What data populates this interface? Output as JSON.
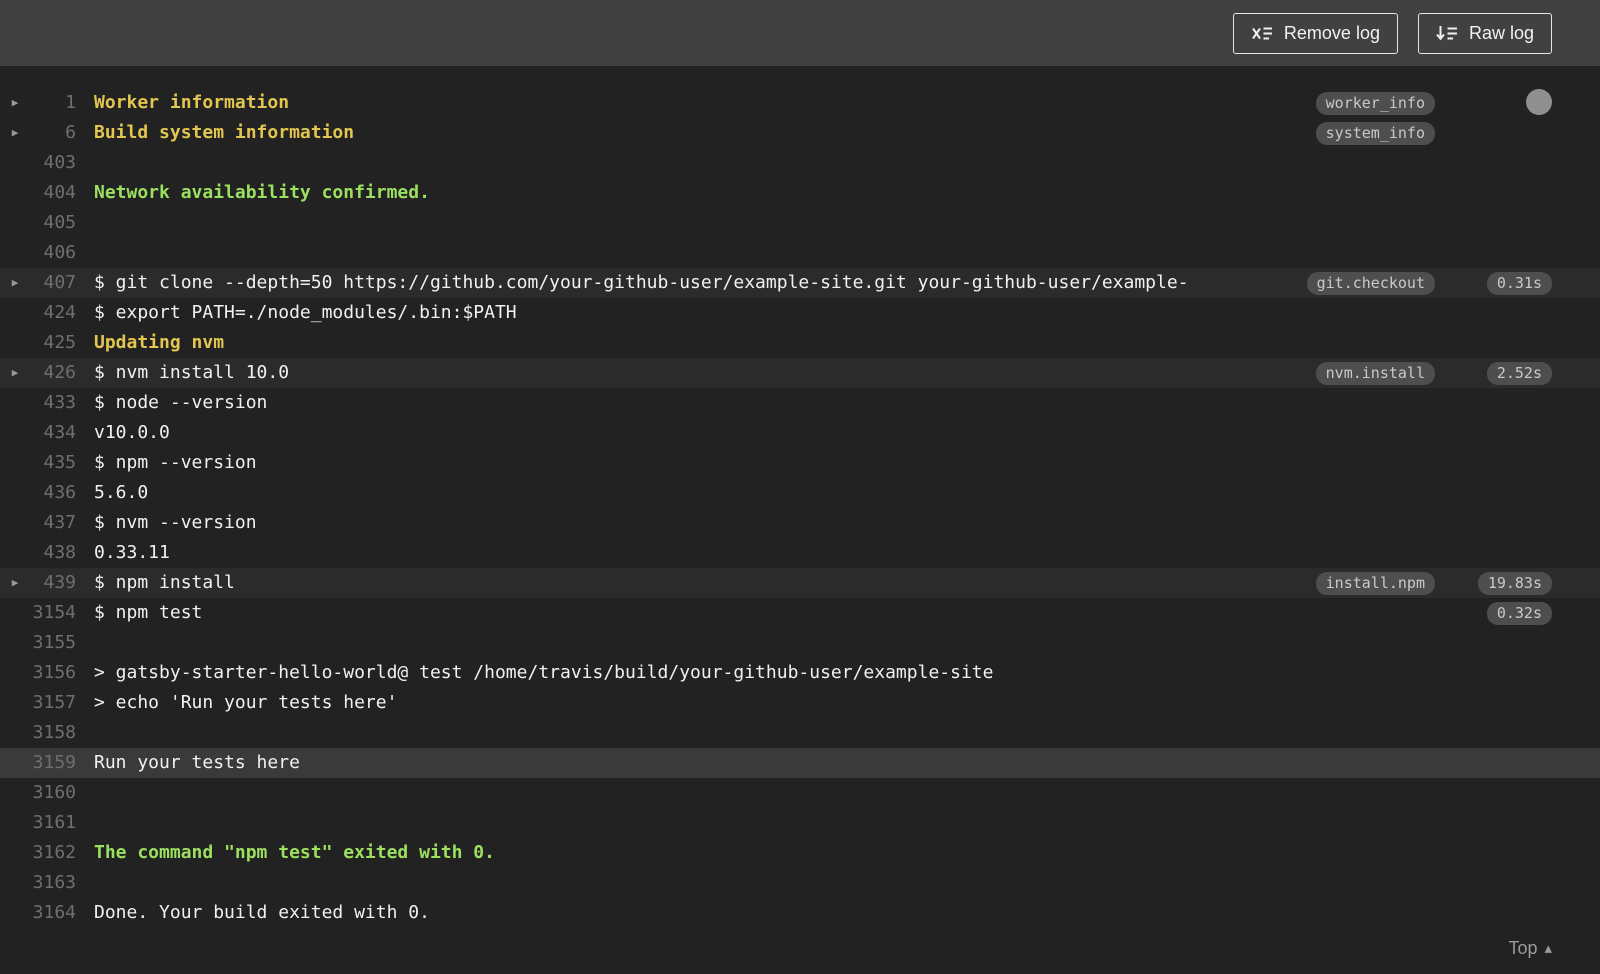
{
  "colors": {
    "page_bg": "#222222",
    "toolbar_bg": "#414141",
    "text": "#f1f1f1",
    "line_number": "#6f6f6f",
    "yellow_text": "#e2c64f",
    "green_text": "#9ce05f",
    "badge_bg": "#4e4e4e",
    "badge_text": "#c9c9c9",
    "fold_row_bg": "#2b2b2b",
    "selected_row_bg": "#3a3a3a"
  },
  "icons": {
    "remove_log": "clear-log-x-with-lines",
    "raw_log": "download-arrow-with-lines",
    "fold_arrow": "▶",
    "top_arrow": "▴",
    "scroll_indicator": "gray-dot"
  },
  "toolbar": {
    "remove_log_label": "Remove log",
    "raw_log_label": "Raw log"
  },
  "log": {
    "lines": [
      {
        "n": "1",
        "text": "Worker information",
        "kind": "yellow",
        "fold": true,
        "badge": "worker_info"
      },
      {
        "n": "6",
        "text": "Build system information",
        "kind": "yellow",
        "fold": true,
        "badge": "system_info"
      },
      {
        "n": "403",
        "text": ""
      },
      {
        "n": "404",
        "text": "Network availability confirmed.",
        "kind": "green"
      },
      {
        "n": "405",
        "text": ""
      },
      {
        "n": "406",
        "text": ""
      },
      {
        "n": "407",
        "text": "$ git clone --depth=50 https://github.com/your-github-user/example-site.git your-github-user/example-",
        "fold": true,
        "badge": "git.checkout",
        "time": "0.31s",
        "highlight": "fold"
      },
      {
        "n": "424",
        "text": "$ export PATH=./node_modules/.bin:$PATH"
      },
      {
        "n": "425",
        "text": "Updating nvm",
        "kind": "yellow"
      },
      {
        "n": "426",
        "text": "$ nvm install 10.0",
        "fold": true,
        "badge": "nvm.install",
        "time": "2.52s",
        "highlight": "fold"
      },
      {
        "n": "433",
        "text": "$ node --version"
      },
      {
        "n": "434",
        "text": "v10.0.0"
      },
      {
        "n": "435",
        "text": "$ npm --version"
      },
      {
        "n": "436",
        "text": "5.6.0"
      },
      {
        "n": "437",
        "text": "$ nvm --version"
      },
      {
        "n": "438",
        "text": "0.33.11"
      },
      {
        "n": "439",
        "text": "$ npm install",
        "fold": true,
        "badge": "install.npm",
        "time": "19.83s",
        "highlight": "fold"
      },
      {
        "n": "3154",
        "text": "$ npm test",
        "time": "0.32s"
      },
      {
        "n": "3155",
        "text": ""
      },
      {
        "n": "3156",
        "text": "> gatsby-starter-hello-world@ test /home/travis/build/your-github-user/example-site"
      },
      {
        "n": "3157",
        "text": "> echo 'Run your tests here'"
      },
      {
        "n": "3158",
        "text": ""
      },
      {
        "n": "3159",
        "text": "Run your tests here",
        "highlight": "selected"
      },
      {
        "n": "3160",
        "text": ""
      },
      {
        "n": "3161",
        "text": ""
      },
      {
        "n": "3162",
        "text": "The command \"npm test\" exited with 0.",
        "kind": "green"
      },
      {
        "n": "3163",
        "text": ""
      },
      {
        "n": "3164",
        "text": "Done. Your build exited with 0."
      }
    ]
  },
  "footer": {
    "top_label": "Top"
  }
}
